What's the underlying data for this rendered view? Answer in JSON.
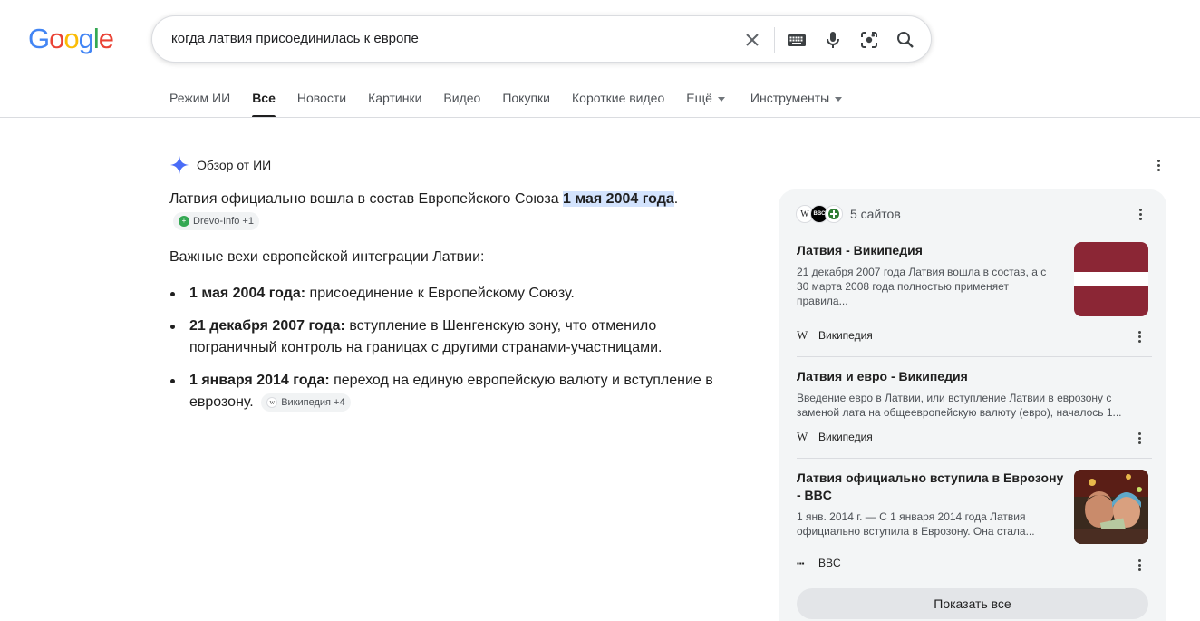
{
  "logo": {
    "letters": [
      "G",
      "o",
      "o",
      "g",
      "l",
      "e"
    ],
    "colors": [
      "#4285f4",
      "#ea4335",
      "#fbbc05",
      "#4285f4",
      "#34a853",
      "#ea4335"
    ]
  },
  "search": {
    "query": "когда латвия присоединилась к европе"
  },
  "icons": {
    "clear": "close-icon",
    "keyboard": "keyboard-icon",
    "voice": "mic-icon",
    "lens": "lens-icon",
    "search": "search-icon"
  },
  "tabs": [
    {
      "label": "Режим ИИ",
      "active": false
    },
    {
      "label": "Все",
      "active": true
    },
    {
      "label": "Новости",
      "active": false
    },
    {
      "label": "Картинки",
      "active": false
    },
    {
      "label": "Видео",
      "active": false
    },
    {
      "label": "Покупки",
      "active": false
    },
    {
      "label": "Короткие видео",
      "active": false
    },
    {
      "label": "Ещё",
      "active": false
    },
    {
      "label": "Инструменты",
      "active": false
    }
  ],
  "ai_overview": {
    "title": "Обзор от ИИ",
    "intro_text": "Латвия официально вошла в состав Европейского Союза ",
    "intro_highlight": "1 мая 2004 года",
    "intro_end": ".",
    "intro_chip": "Drevo-Info +1",
    "milestones_heading": "Важные вехи европейской интеграции Латвии:",
    "items": [
      {
        "bold": "1 мая 2004 года:",
        "text": " присоединение к Европейскому Союзу."
      },
      {
        "bold": "21 декабря 2007 года:",
        "text": " вступление в Шенгенскую зону, что отменило пограничный контроль на границах с другими странами-участницами."
      },
      {
        "bold": "1 января 2014 года:",
        "text": " переход на единую европейскую валюту и вступление в еврозону."
      }
    ],
    "last_chip": "Википедия +4"
  },
  "sources": {
    "count_label": "5 сайтов",
    "items": [
      {
        "title": "Латвия - Википедия",
        "snippet": "21 декабря 2007 года Латвия вошла в состав, а с 30 марта 2008 года полностью применяет правила...",
        "site": "Википедия",
        "site_icon": "W"
      },
      {
        "title": "Латвия и евро - Википедия",
        "snippet": "Введение евро в Латвии, или вступление Латвии в еврозону с заменой лата на общеевропейскую валюту (евро), началось 1...",
        "site": "Википедия",
        "site_icon": "W"
      },
      {
        "title": "Латвия официально вступила в Еврозону - BBC",
        "snippet": "1 янв. 2014 г. — С 1 января 2014 года Латвия официально вступила в Еврозону. Она стала...",
        "site": "BBC",
        "site_icon": "BBC"
      }
    ],
    "show_all": "Показать все"
  },
  "colors": {
    "flag_red": "#8b2635",
    "highlight": "#d3e3fd",
    "ai_star": "#4a6cf7"
  }
}
